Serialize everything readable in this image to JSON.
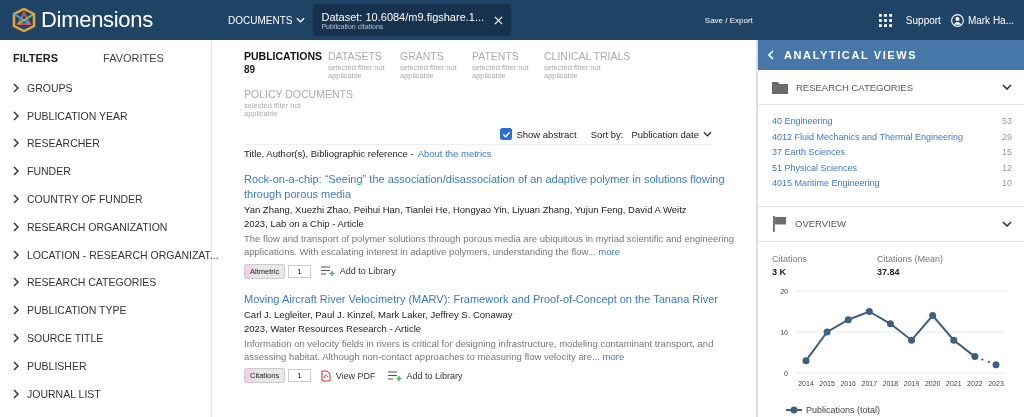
{
  "header": {
    "logo": "Dimensions",
    "documents_menu": "DOCUMENTS",
    "filter_chip": {
      "title": "Dataset: 10.6084/m9.figshare.1...",
      "subtitle": "Publication citations"
    },
    "save_export": "Save / Export",
    "support": "Support",
    "user": "Mark Ha..."
  },
  "sidebar": {
    "tabs": [
      {
        "label": "FILTERS",
        "selected": true
      },
      {
        "label": "FAVORITES",
        "selected": false
      }
    ],
    "items": [
      "GROUPS",
      "PUBLICATION YEAR",
      "RESEARCHER",
      "FUNDER",
      "COUNTRY OF FUNDER",
      "RESEARCH ORGANIZATION",
      "LOCATION - RESEARCH ORGANIZAT...",
      "RESEARCH CATEGORIES",
      "PUBLICATION TYPE",
      "SOURCE TITLE",
      "PUBLISHER",
      "JOURNAL LIST"
    ]
  },
  "doc_tabs": [
    {
      "label": "PUBLICATIONS",
      "count": "89",
      "selected": true
    },
    {
      "label": "DATASETS",
      "note": "selected filter not applicable",
      "selected": false
    },
    {
      "label": "GRANTS",
      "note": "selected filter not applicable",
      "selected": false
    },
    {
      "label": "PATENTS",
      "note": "selected filter not applicable",
      "selected": false
    },
    {
      "label": "CLINICAL TRIALS",
      "note": "selected filter not applicable",
      "selected": false
    },
    {
      "label": "POLICY DOCUMENTS",
      "note": "selected filter not applicable",
      "selected": false
    }
  ],
  "show_abstract": {
    "label": "Show abstract",
    "checked": true
  },
  "sort": {
    "label": "Sort by:",
    "value": "Publication date"
  },
  "columns_note": {
    "text": "Title, Author(s), Bibliographic reference -",
    "link": "About the metrics"
  },
  "results": [
    {
      "title": "Rock-on-a-chip: “Seeing” the association/disassociation of an adaptive polymer in solutions flowing through porous media",
      "authors": "Yan Zhang, Xuezhi Zhao, Peihui Han, Tianlei He, Hongyao Yin, Liyuan Zhang, Yujun Feng, David A Weitz",
      "source": "2023, Lab on a Chip - Article",
      "abstract": "The flow and transport of polymer solutions through porous media are ubiquitous in myriad scientific and engineering applications. With escalating interest in adaptive polymers, understanding the flow...",
      "more": "more",
      "badge": "Altmetric",
      "badge_count": "1",
      "actions": [
        "Add to Library"
      ]
    },
    {
      "title": "Moving Aircraft River Velocimetry (MARV): Framework and Proof-of-Concept on the Tanana River",
      "authors": "Carl J. Legleiter, Paul J. Kinzel, Mark Laker, Jeffrey S. Conaway",
      "source": "2023, Water Resources Research - Article",
      "abstract": "Information on velocity fields in rivers is critical for designing infrastructure, modeling contaminant transport, and assessing habitat. Although non-contact approaches to measuring flow velocity are...",
      "more": "more",
      "badge": "Citations",
      "badge_count": "1",
      "actions": [
        "View PDF",
        "Add to Library"
      ]
    }
  ],
  "analytical_views": {
    "title": "ANALYTICAL VIEWS",
    "research_categories": {
      "title": "RESEARCH CATEGORIES",
      "items": [
        {
          "name": "40 Engineering",
          "count": "53"
        },
        {
          "name": "4012 Fluid Mechanics and Thermal Engineering",
          "count": "29"
        },
        {
          "name": "37 Earth Sciences",
          "count": "15"
        },
        {
          "name": "51 Physical Sciences",
          "count": "12"
        },
        {
          "name": "4015 Maritime Engineering",
          "count": "10"
        }
      ]
    },
    "overview": {
      "title": "OVERVIEW",
      "stats": [
        {
          "label": "Citations",
          "value": "3 K"
        },
        {
          "label": "Citations (Mean)",
          "value": "37.84"
        }
      ],
      "chart_data": {
        "type": "line",
        "categories": [
          "2014",
          "2015",
          "2016",
          "2017",
          "2018",
          "2019",
          "2020",
          "2021",
          "2022",
          "2023"
        ],
        "series": [
          {
            "name": "Publications (total)",
            "color": "#3f5f7f",
            "marker": "circle",
            "values": [
              3,
              10,
              13,
              15,
              12,
              8,
              14,
              8,
              4,
              2
            ]
          }
        ],
        "ylim": [
          0,
          20
        ],
        "yticks": [
          0,
          10,
          20
        ]
      }
    }
  }
}
